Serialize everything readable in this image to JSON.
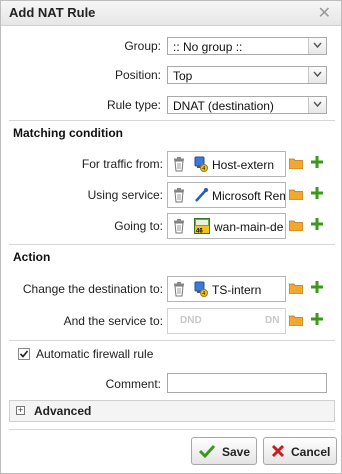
{
  "window": {
    "title": "Add NAT Rule"
  },
  "fields": {
    "group": {
      "label": "Group:",
      "value": ":: No group ::"
    },
    "position": {
      "label": "Position:",
      "value": "Top"
    },
    "rule_type": {
      "label": "Rule type:",
      "value": "DNAT (destination)"
    }
  },
  "matching": {
    "heading": "Matching condition",
    "for_traffic_from": {
      "label": "For traffic from:",
      "value": "Host-extern"
    },
    "using_service": {
      "label": "Using service:",
      "value": "Microsoft Rem"
    },
    "going_to": {
      "label": "Going to:",
      "value": "wan-main-de"
    }
  },
  "action": {
    "heading": "Action",
    "change_destination": {
      "label": "Change the destination to:",
      "value": "TS-intern"
    },
    "and_service": {
      "label": "And the service to:",
      "placeholder_left": "DND",
      "placeholder_right": "DN"
    }
  },
  "automatic_firewall_rule": {
    "label": "Automatic firewall rule",
    "checked": true
  },
  "comment": {
    "label": "Comment:",
    "value": ""
  },
  "advanced": {
    "label": "Advanced",
    "expander": "+"
  },
  "buttons": {
    "save": "Save",
    "cancel": "Cancel"
  },
  "icons": {
    "close": "close-icon",
    "dropdown": "chevron-down-icon",
    "trash": "trash-icon",
    "host": "host-icon",
    "service": "service-icon",
    "interface": "network-interface-icon",
    "folder": "folder-icon",
    "plus": "plus-icon",
    "check": "check-icon",
    "cancel": "cancel-icon"
  },
  "colors": {
    "green": "#3a9a1a",
    "red": "#c81e1e",
    "folder": "#f0a830"
  }
}
